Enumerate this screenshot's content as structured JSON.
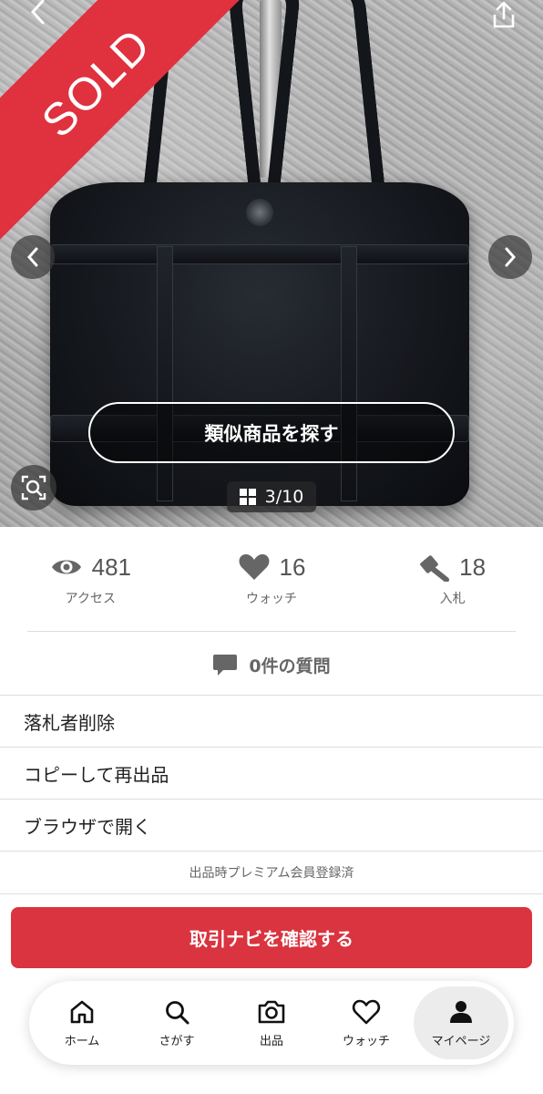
{
  "hero": {
    "badge_text": "SOLD",
    "similar_button_label": "類似商品を探す",
    "image_counter": "3/10"
  },
  "stats": [
    {
      "icon": "eye-icon",
      "value": "481",
      "label": "アクセス"
    },
    {
      "icon": "heart-icon",
      "value": "16",
      "label": "ウォッチ"
    },
    {
      "icon": "gavel-icon",
      "value": "18",
      "label": "入札"
    }
  ],
  "questions": {
    "icon": "chat-bubble-icon",
    "label": "0件の質問"
  },
  "menu": {
    "items": [
      "落札者削除",
      "コピーして再出品",
      "ブラウザで開く"
    ],
    "premium_note": "出品時プレミアム会員登録済"
  },
  "cta_label": "取引ナビを確認する",
  "bottom_nav": [
    {
      "icon": "home-icon",
      "label": "ホーム"
    },
    {
      "icon": "search-icon",
      "label": "さがす"
    },
    {
      "icon": "camera-icon",
      "label": "出品"
    },
    {
      "icon": "heart-outline-icon",
      "label": "ウォッチ"
    },
    {
      "icon": "user-icon",
      "label": "マイページ",
      "active": true
    }
  ],
  "colors": {
    "brand_red": "#d9343f",
    "sold_red": "#e0313f"
  }
}
